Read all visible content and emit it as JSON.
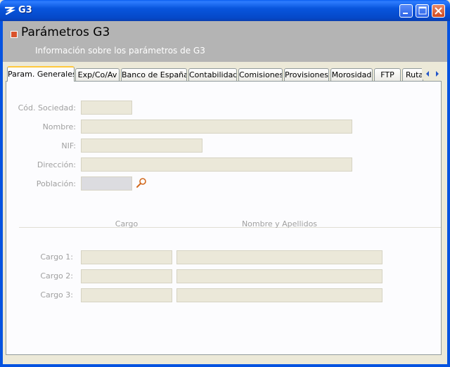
{
  "window": {
    "title": "G3",
    "minimize_icon": "minimize-icon",
    "maximize_icon": "maximize-icon",
    "close_icon": "close-icon"
  },
  "header": {
    "title": "Parámetros G3",
    "subtitle": "Información sobre los parámetros de G3"
  },
  "tabs": [
    {
      "label": "Param. Generales",
      "active": true
    },
    {
      "label": "Exp/Co/Av"
    },
    {
      "label": "Banco de España"
    },
    {
      "label": "Contabilidad"
    },
    {
      "label": "Comisiones"
    },
    {
      "label": "Provisiones"
    },
    {
      "label": "Morosidad"
    },
    {
      "label": "FTP"
    },
    {
      "label": "Rutas"
    }
  ],
  "form": {
    "cod_sociedad_label": "Cód. Sociedad:",
    "cod_sociedad_value": "",
    "nombre_label": "Nombre:",
    "nombre_value": "",
    "nif_label": "NIF:",
    "nif_value": "",
    "direccion_label": "Dirección:",
    "direccion_value": "",
    "poblacion_label": "Población:",
    "poblacion_value": ""
  },
  "cargos": {
    "col_cargo": "Cargo",
    "col_nombre": "Nombre y Apellidos",
    "rows": [
      {
        "label": "Cargo 1:",
        "cargo": "",
        "nombre": ""
      },
      {
        "label": "Cargo 2:",
        "cargo": "",
        "nombre": ""
      },
      {
        "label": "Cargo 3:",
        "cargo": "",
        "nombre": ""
      }
    ]
  },
  "colors": {
    "titlebar": "#0548c8",
    "header_bg": "#b4b4b4",
    "active_tab_accent": "#ffc83c",
    "field_bg": "#ebe8d9"
  }
}
